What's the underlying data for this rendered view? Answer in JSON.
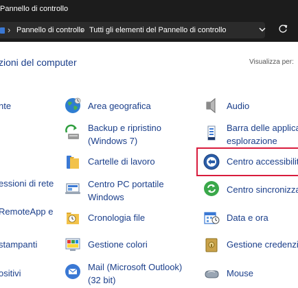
{
  "window": {
    "title": "Pannello di controllo"
  },
  "address_bar": {
    "crumbs": [
      "Pannello di controllo",
      "Tutti gli elementi del Pannello di controllo"
    ],
    "separator": "›"
  },
  "header": {
    "heading": "zioni del computer",
    "view_by_label": "Visualizza per:"
  },
  "items": {
    "left_col": [
      {
        "label": "nte"
      },
      {
        "label": "essioni di rete"
      },
      {
        "label": "RemoteApp e"
      },
      {
        "label": "stampanti"
      },
      {
        "label": "ositivi"
      }
    ],
    "middle_col": [
      {
        "label": "Area geografica",
        "icon": "globe-icon"
      },
      {
        "label": "Backup e ripristino",
        "label2": "(Windows 7)",
        "icon": "backup-icon"
      },
      {
        "label": "Cartelle di lavoro",
        "icon": "work-folders-icon"
      },
      {
        "label": "Centro PC portatile",
        "label2": "Windows",
        "icon": "mobility-center-icon"
      },
      {
        "label": "Cronologia file",
        "icon": "file-history-icon"
      },
      {
        "label": "Gestione colori",
        "icon": "color-management-icon"
      },
      {
        "label": "Mail (Microsoft Outlook)",
        "label2": "(32 bit)",
        "icon": "mail-icon"
      }
    ],
    "right_col": [
      {
        "label": "Audio",
        "icon": "speaker-icon"
      },
      {
        "label": "Barra delle applica",
        "label2": "esplorazione",
        "icon": "taskbar-icon"
      },
      {
        "label": "Centro accessibilit",
        "icon": "ease-of-access-icon",
        "highlight_color": "#d81b3c"
      },
      {
        "label": "Centro sincronizza",
        "icon": "sync-center-icon"
      },
      {
        "label": "Data e ora",
        "icon": "calendar-icon"
      },
      {
        "label": "Gestione credenzia",
        "icon": "credential-vault-icon"
      },
      {
        "label": "Mouse",
        "icon": "mouse-icon"
      }
    ]
  },
  "colors": {
    "link": "#1a3e8a",
    "titlebar": "#1c1c1c",
    "highlight": "#d81b3c"
  }
}
